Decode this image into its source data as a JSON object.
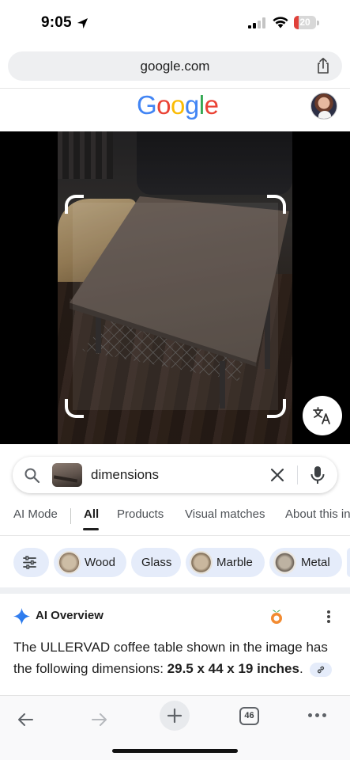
{
  "status_bar": {
    "time": "9:05",
    "battery_percent": "20",
    "battery_level": 0.2
  },
  "browser": {
    "url": "google.com"
  },
  "google": {
    "logo_letters": [
      {
        "char": "G",
        "color": "#4285F4"
      },
      {
        "char": "o",
        "color": "#EA4335"
      },
      {
        "char": "o",
        "color": "#FBBC05"
      },
      {
        "char": "g",
        "color": "#4285F4"
      },
      {
        "char": "l",
        "color": "#34A853"
      },
      {
        "char": "e",
        "color": "#EA4335"
      }
    ]
  },
  "search": {
    "query": "dimensions"
  },
  "tabs": [
    {
      "label": "AI Mode",
      "active": false
    },
    {
      "label": "All",
      "active": true
    },
    {
      "label": "Products",
      "active": false
    },
    {
      "label": "Visual matches",
      "active": false
    },
    {
      "label": "About this in",
      "active": false
    }
  ],
  "chips": [
    {
      "label": "Wood",
      "icon": "wood-thumb"
    },
    {
      "label": "Glass",
      "icon": null
    },
    {
      "label": "Marble",
      "icon": "marble-thumb"
    },
    {
      "label": "Metal",
      "icon": "metal-thumb"
    }
  ],
  "ai_overview": {
    "title": "AI Overview",
    "text_prefix": "The ULLERVAD coffee table shown in the image has the following dimensions: ",
    "text_bold": "29.5 x 44 x 19 inches",
    "text_suffix": "."
  },
  "toolbar": {
    "tab_count": "46"
  },
  "colors": {
    "accent_blue": "#4285F4",
    "chip_bg": "#e5ecfa",
    "battery_low": "#e0403a"
  }
}
